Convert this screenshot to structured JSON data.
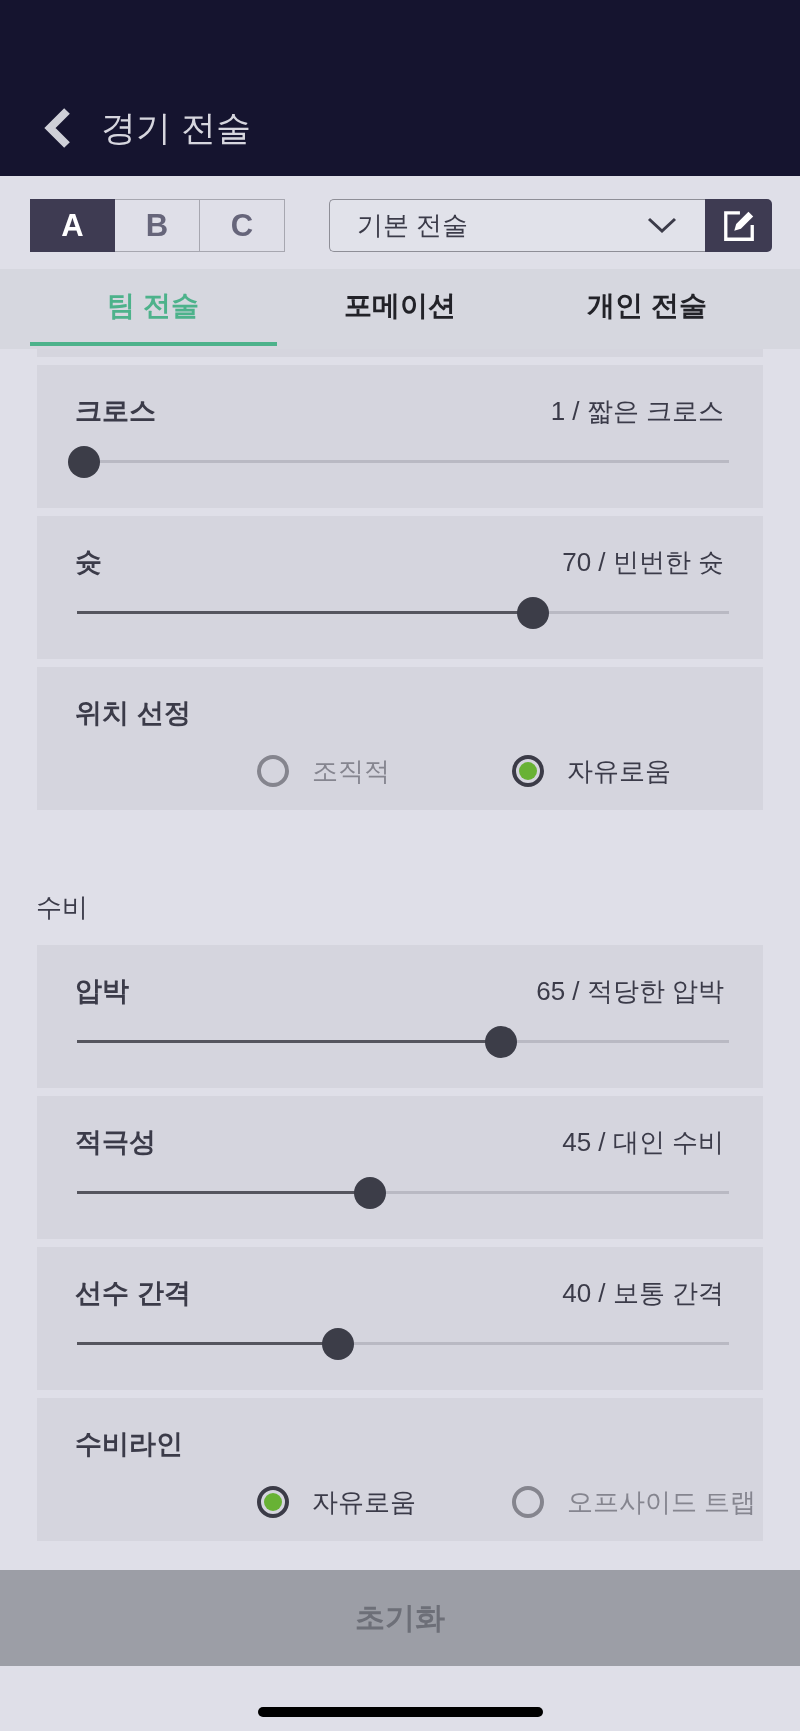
{
  "header": {
    "title": "경기 전술"
  },
  "slots": [
    {
      "label": "A",
      "selected": true
    },
    {
      "label": "B",
      "selected": false
    },
    {
      "label": "C",
      "selected": false
    }
  ],
  "tactic_select": {
    "value": "기본 전술"
  },
  "tabs": [
    {
      "label": "팀 전술",
      "selected": true
    },
    {
      "label": "포메이션",
      "selected": false
    },
    {
      "label": "개인 전술",
      "selected": false
    }
  ],
  "sections": [
    {
      "settings": [
        {
          "kind": "slider",
          "label": "크로스",
          "reading": "1 / 짧은 크로스",
          "level": 0.01
        },
        {
          "kind": "slider",
          "label": "슛",
          "reading": "70 / 빈번한 슛",
          "level": 0.7
        },
        {
          "kind": "choice",
          "label": "위치 선정",
          "options": [
            {
              "label": "조직적",
              "selected": false
            },
            {
              "label": "자유로움",
              "selected": true
            }
          ]
        }
      ]
    },
    {
      "title": "수비",
      "settings": [
        {
          "kind": "slider",
          "label": "압박",
          "reading": "65 / 적당한 압박",
          "level": 0.65
        },
        {
          "kind": "slider",
          "label": "적극성",
          "reading": "45 / 대인 수비",
          "level": 0.45
        },
        {
          "kind": "slider",
          "label": "선수 간격",
          "reading": "40 / 보통 간격",
          "level": 0.4
        },
        {
          "kind": "choice",
          "label": "수비라인",
          "options": [
            {
              "label": "자유로움",
              "selected": true
            },
            {
              "label": "오프사이드 트랩",
              "selected": false
            }
          ]
        }
      ]
    }
  ],
  "reset_button": {
    "label": "초기화"
  }
}
